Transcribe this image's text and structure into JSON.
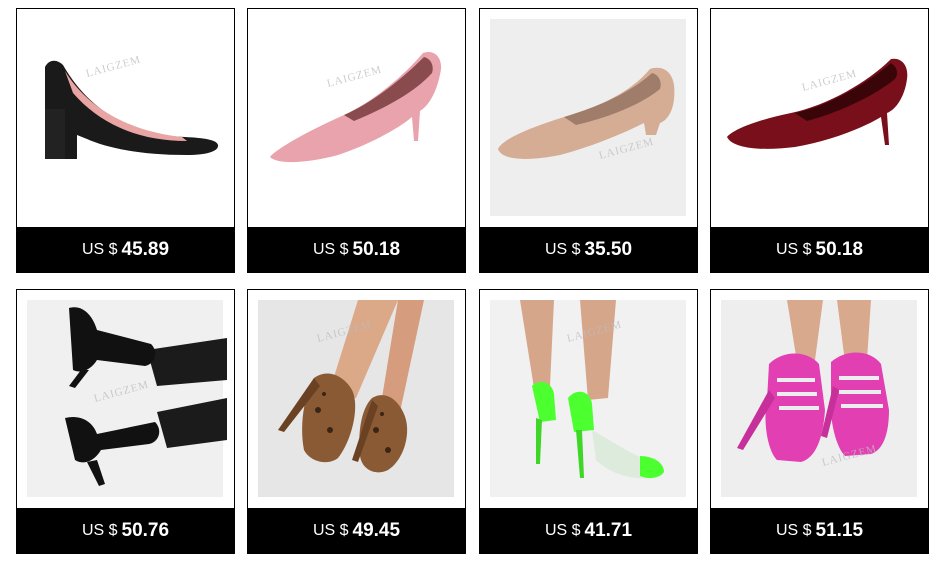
{
  "products": [
    {
      "image": "black-leather-block-heel-pump",
      "currency": "US $",
      "price": "45.89"
    },
    {
      "image": "pink-kitten-heel-pump",
      "currency": "US $",
      "price": "50.18"
    },
    {
      "image": "nude-block-heel-pump",
      "currency": "US $",
      "price": "35.50"
    },
    {
      "image": "burgundy-patent-stiletto-pump",
      "currency": "US $",
      "price": "50.18"
    },
    {
      "image": "black-platform-ankle-strap-heel",
      "currency": "US $",
      "price": "50.76"
    },
    {
      "image": "leopard-peep-toe-platform-heel",
      "currency": "US $",
      "price": "49.45"
    },
    {
      "image": "neon-green-clear-stiletto",
      "currency": "US $",
      "price": "41.71"
    },
    {
      "image": "pink-lace-up-platform-heel",
      "currency": "US $",
      "price": "51.15"
    }
  ],
  "watermark": "LAIGZEM"
}
